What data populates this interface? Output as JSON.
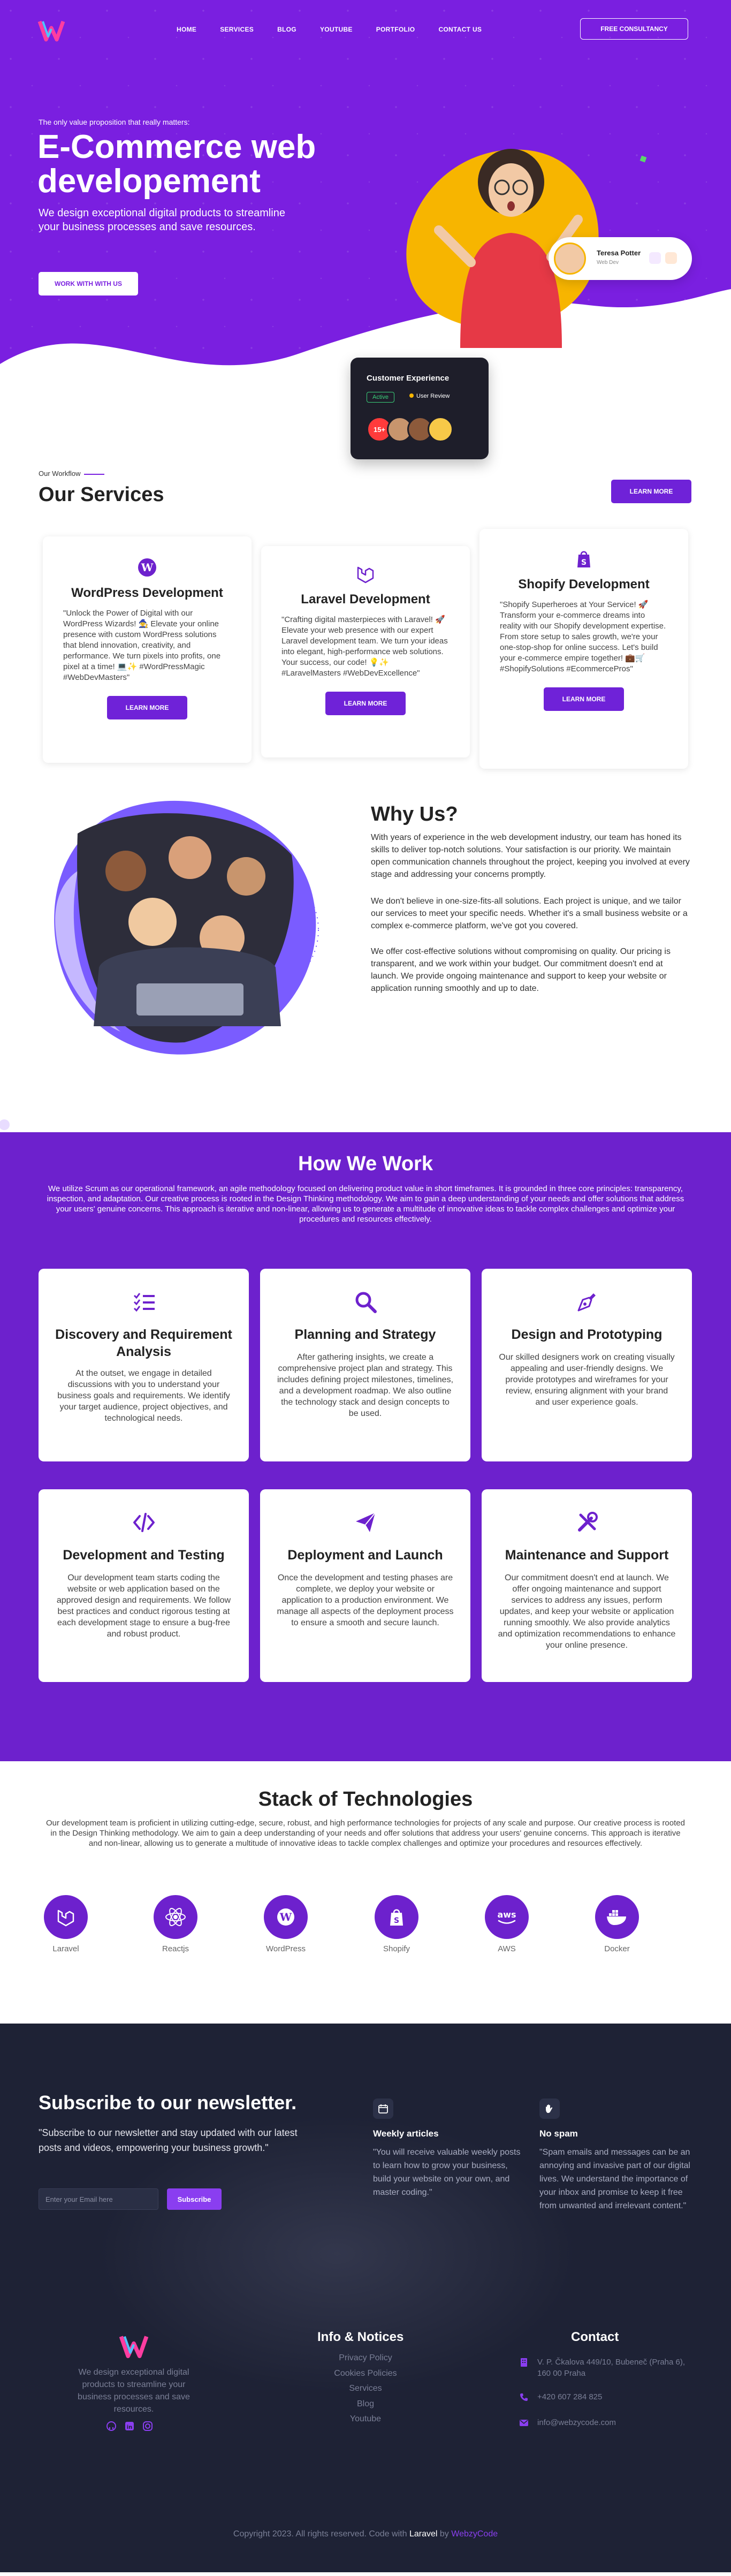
{
  "nav": {
    "links": [
      "HOME",
      "SERVICES",
      "BLOG",
      "YOUTUBE",
      "PORTFOLIO",
      "CONTACT US"
    ],
    "cta": "FREE CONSULTANCY"
  },
  "hero": {
    "kicker": "The only value proposition that really matters:",
    "title": "E-Commerce web developement",
    "desc": "We design exceptional digital products to streamline your business processes and save resources.",
    "btn": "WORK WITH WITH US",
    "profile": {
      "name": "Teresa Potter",
      "role": "Web Dev"
    },
    "cx": {
      "title": "Customer Experience",
      "status": "Active",
      "review": "User Review",
      "count": "15+"
    }
  },
  "services": {
    "eyebrow": "Our Workflow",
    "title": "Our Services",
    "learn_more": "LEARN MORE",
    "cards": [
      {
        "title": "WordPress Development",
        "text": "\"Unlock the Power of Digital with our WordPress Wizards! 🧙 Elevate your online presence with custom WordPress solutions that blend innovation, creativity, and performance. We turn pixels into profits, one pixel at a time! 💻✨ #WordPressMagic #WebDevMasters\"",
        "btn": "LEARN MORE"
      },
      {
        "title": "Laravel Development",
        "text": "\"Crafting digital masterpieces with Laravel! 🚀 Elevate your web presence with our expert Laravel development team. We turn your ideas into elegant, high-performance web solutions. Your success, our code! 💡✨ #LaravelMasters #WebDevExcellence\"",
        "btn": "LEARN MORE"
      },
      {
        "title": "Shopify Development",
        "text": "\"Shopify Superheroes at Your Service! 🚀 Transform your e-commerce dreams into reality with our Shopify development expertise. From store setup to sales growth, we're your one-stop-shop for online success. Let's build your e-commerce empire together! 💼🛒 #ShopifySolutions #EcommercePros\"",
        "btn": "LEARN MORE"
      }
    ]
  },
  "why": {
    "title": "Why Us?",
    "paragraphs": [
      "With years of experience in the web development industry, our team has honed its skills to deliver top-notch solutions. Your satisfaction is our priority. We maintain open communication channels throughout the project, keeping you involved at every stage and addressing your concerns promptly.",
      "We don't believe in one-size-fits-all solutions. Each project is unique, and we tailor our services to meet your specific needs. Whether it's a small business website or a complex e-commerce platform, we've got you covered.",
      "We offer cost-effective solutions without compromising on quality. Our pricing is transparent, and we work within your budget. Our commitment doesn't end at launch. We provide ongoing maintenance and support to keep your website or application running smoothly and up to date."
    ]
  },
  "how": {
    "title": "How We Work",
    "intro": "We utilize Scrum as our operational framework, an agile methodology focused on delivering product value in short timeframes. It is grounded in three core principles: transparency, inspection, and adaptation. Our creative process is rooted in the Design Thinking methodology. We aim to gain a deep understanding of your needs and offer solutions that address your users' genuine concerns. This approach is iterative and non-linear, allowing us to generate a multitude of innovative ideas to tackle complex challenges and optimize your procedures and resources effectively.",
    "steps": [
      {
        "title": "Discovery and Requirement Analysis",
        "text": "At the outset, we engage in detailed discussions with you to understand your business goals and requirements. We identify your target audience, project objectives, and technological needs."
      },
      {
        "title": "Planning and Strategy",
        "text": "After gathering insights, we create a comprehensive project plan and strategy. This includes defining project milestones, timelines, and a development roadmap. We also outline the technology stack and design concepts to be used."
      },
      {
        "title": "Design and Prototyping",
        "text": "Our skilled designers work on creating visually appealing and user-friendly designs. We provide prototypes and wireframes for your review, ensuring alignment with your brand and user experience goals."
      },
      {
        "title": "Development and Testing",
        "text": "Our development team starts coding the website or web application based on the approved design and requirements. We follow best practices and conduct rigorous testing at each development stage to ensure a bug-free and robust product."
      },
      {
        "title": "Deployment and Launch",
        "text": "Once the development and testing phases are complete, we deploy your website or application to a production environment. We manage all aspects of the deployment process to ensure a smooth and secure launch."
      },
      {
        "title": "Maintenance and Support",
        "text": "Our commitment doesn't end at launch. We offer ongoing maintenance and support services to address any issues, perform updates, and keep your website or application running smoothly. We also provide analytics and optimization recommendations to enhance your online presence."
      }
    ]
  },
  "stack": {
    "title": "Stack of Technologies",
    "intro": "Our development team is proficient in utilizing cutting-edge, secure, robust, and high performance technologies for projects of any scale and purpose. Our creative process is rooted in the Design Thinking methodology. We aim to gain a deep understanding of your needs and offer solutions that address your users' genuine concerns. This approach is iterative and non-linear, allowing us to generate a multitude of innovative ideas to tackle complex challenges and optimize your procedures and resources effectively.",
    "techs": [
      "Laravel",
      "Reactjs",
      "WordPress",
      "Shopify",
      "AWS",
      "Docker"
    ]
  },
  "newsletter": {
    "title": "Subscribe to our newsletter.",
    "desc": "\"Subscribe to our newsletter and stay updated with our latest posts and videos, empowering your business growth.\"",
    "placeholder": "Enter your Email here",
    "btn": "Subscribe",
    "features": [
      {
        "title": "Weekly articles",
        "text": "\"You will receive valuable weekly posts to learn how to grow your business, build your website on your own, and master coding.\""
      },
      {
        "title": "No spam",
        "text": "\"Spam emails and messages can be an annoying and invasive part of our digital lives. We understand the importance of your inbox and promise to keep it free from unwanted and irrelevant content.\""
      }
    ]
  },
  "footer": {
    "about": "We design exceptional digital products to streamline your business processes and save resources.",
    "info_title": "Info & Notices",
    "links": [
      "Privacy Policy",
      "Cookies Policies",
      "Services",
      "Blog",
      "Youtube"
    ],
    "contact_title": "Contact",
    "address": "V. P. Čkalova 449/10, Bubeneč (Praha 6), 160 00 Praha",
    "phone": "+420 607 284 825",
    "email": "info@webzycode.com",
    "copyright": "Copyright 2023. All rights reserved. Code with",
    "framework": "Laravel",
    "by": "by",
    "brand": "WebzyCode"
  }
}
